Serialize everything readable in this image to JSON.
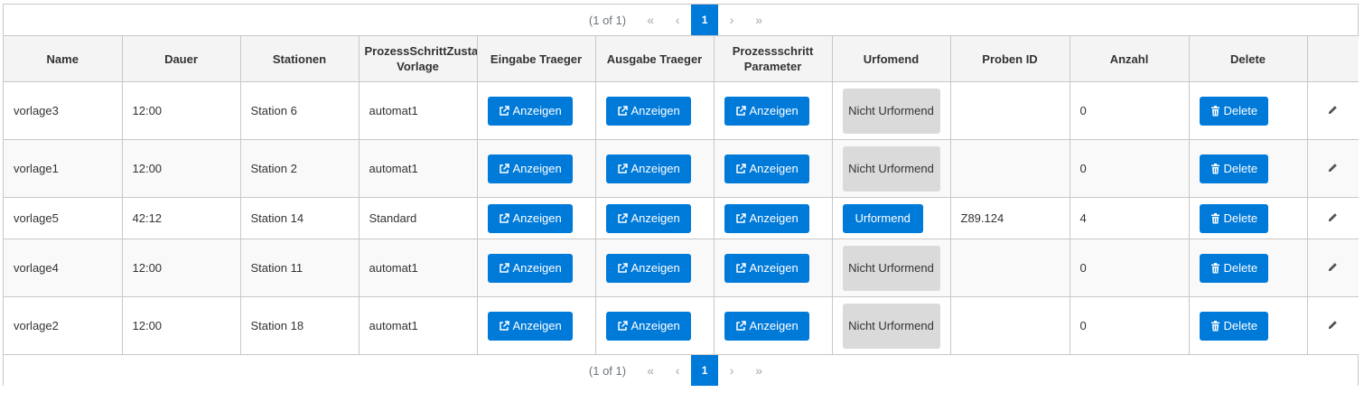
{
  "pagination": {
    "report": "(1 of 1)",
    "current_page": "1",
    "first_icon": "double-chevron-left-icon",
    "prev_icon": "chevron-left-icon",
    "next_icon": "chevron-right-icon",
    "last_icon": "double-chevron-right-icon"
  },
  "columns": [
    "Name",
    "Dauer",
    "Stationen",
    "ProzessSchrittZustand Vorlage",
    "Eingabe Traeger",
    "Ausgabe Traeger",
    "Prozessschritt Parameter",
    "Urfomend",
    "Proben ID",
    "Anzahl",
    "Delete",
    ""
  ],
  "rows": [
    {
      "name": "vorlage3",
      "dauer": "12:00",
      "stationen": "Station 6",
      "vorlage": "automat1",
      "eingabe": "Anzeigen",
      "ausgabe": "Anzeigen",
      "parameter": "Anzeigen",
      "urformend": "Nicht Urformend",
      "proben_id": "",
      "anzahl": "0",
      "delete": "Delete"
    },
    {
      "name": "vorlage1",
      "dauer": "12:00",
      "stationen": "Station 2",
      "vorlage": "automat1",
      "eingabe": "Anzeigen",
      "ausgabe": "Anzeigen",
      "parameter": "Anzeigen",
      "urformend": "Nicht Urformend",
      "proben_id": "",
      "anzahl": "0",
      "delete": "Delete"
    },
    {
      "name": "vorlage5",
      "dauer": "42:12",
      "stationen": "Station 14",
      "vorlage": "Standard",
      "eingabe": "Anzeigen",
      "ausgabe": "Anzeigen",
      "parameter": "Anzeigen",
      "urformend": "Urformend",
      "proben_id": "Z89.124",
      "anzahl": "4",
      "delete": "Delete"
    },
    {
      "name": "vorlage4",
      "dauer": "12:00",
      "stationen": "Station 11",
      "vorlage": "automat1",
      "eingabe": "Anzeigen",
      "ausgabe": "Anzeigen",
      "parameter": "Anzeigen",
      "urformend": "Nicht Urformend",
      "proben_id": "",
      "anzahl": "0",
      "delete": "Delete"
    },
    {
      "name": "vorlage2",
      "dauer": "12:00",
      "stationen": "Station 18",
      "vorlage": "automat1",
      "eingabe": "Anzeigen",
      "ausgabe": "Anzeigen",
      "parameter": "Anzeigen",
      "urformend": "Nicht Urformend",
      "proben_id": "",
      "anzahl": "0",
      "delete": "Delete"
    }
  ],
  "icons": {
    "anzeigen": "external-link-icon",
    "delete": "trash-icon",
    "edit": "pencil-icon"
  },
  "colors": {
    "primary": "#007ad9",
    "secondary": "#dadada",
    "border": "#c8c8c8",
    "header_bg": "#f4f4f4"
  }
}
